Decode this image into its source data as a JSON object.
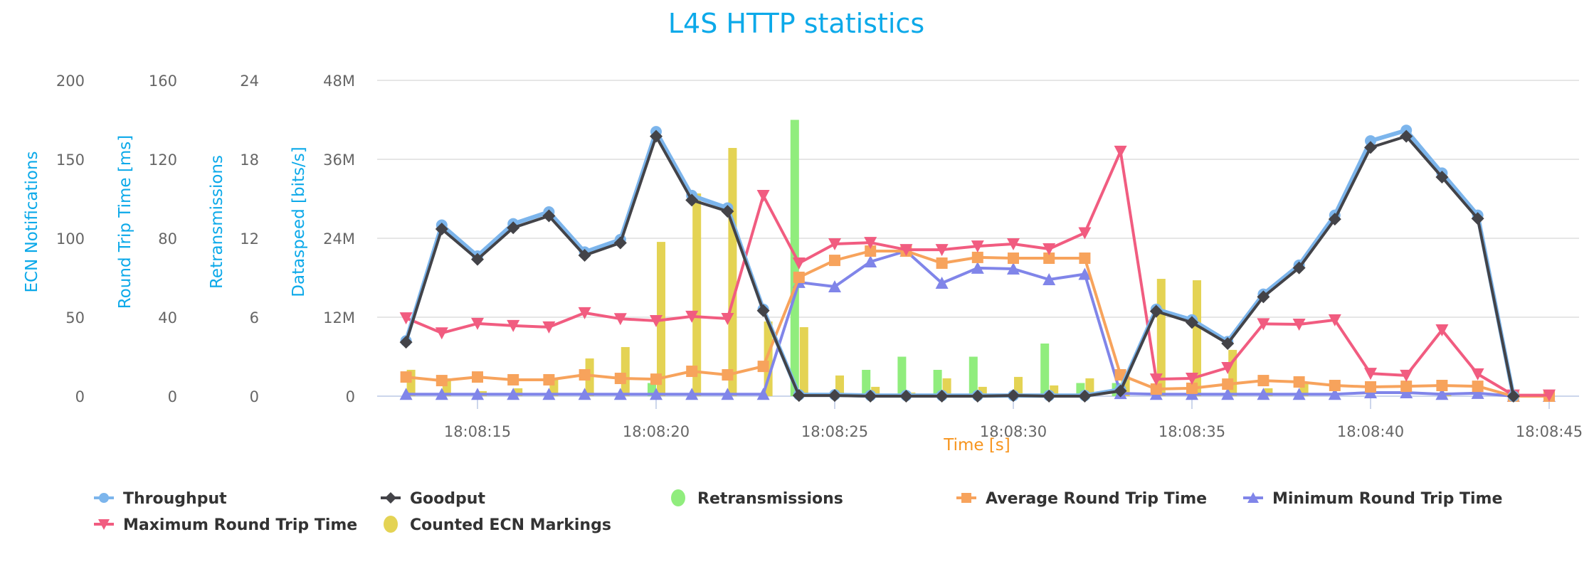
{
  "chart_data": {
    "type": "line",
    "title": "L4S HTTP statistics",
    "xlabel": "Time [s]",
    "x": [
      "18:08:13",
      "18:08:14",
      "18:08:15",
      "18:08:16",
      "18:08:17",
      "18:08:18",
      "18:08:19",
      "18:08:20",
      "18:08:21",
      "18:08:22",
      "18:08:23",
      "18:08:24",
      "18:08:25",
      "18:08:26",
      "18:08:27",
      "18:08:28",
      "18:08:29",
      "18:08:30",
      "18:08:31",
      "18:08:32",
      "18:08:33",
      "18:08:34",
      "18:08:35",
      "18:08:36",
      "18:08:37",
      "18:08:38",
      "18:08:39",
      "18:08:40",
      "18:08:41",
      "18:08:42",
      "18:08:43",
      "18:08:44",
      "18:08:45"
    ],
    "x_tick_labels": [
      "18:08:15",
      "18:08:20",
      "18:08:25",
      "18:08:30",
      "18:08:35",
      "18:08:40",
      "18:08:45"
    ],
    "grid": true,
    "legend_position": "bottom",
    "y_axes": [
      {
        "id": "ecn",
        "title": "ECN Notifications",
        "range": [
          0,
          200
        ],
        "ticks": [
          "0",
          "50",
          "100",
          "150",
          "200"
        ]
      },
      {
        "id": "rtt",
        "title": "Round Trip Time [ms]",
        "range": [
          0,
          160
        ],
        "ticks": [
          "0",
          "40",
          "80",
          "120",
          "160"
        ]
      },
      {
        "id": "retrans",
        "title": "Retransmissions",
        "range": [
          0,
          24
        ],
        "ticks": [
          "0",
          "6",
          "12",
          "18",
          "24"
        ]
      },
      {
        "id": "speed",
        "title": "Dataspeed [bits/s]",
        "range": [
          0,
          48000000
        ],
        "ticks": [
          "0",
          "12M",
          "24M",
          "36M",
          "48M"
        ]
      }
    ],
    "series": [
      {
        "name": "Throughput",
        "kind": "line",
        "axis": "speed",
        "unit_scale": 1000000,
        "color": "#7cb5ec",
        "marker": "circle",
        "values": [
          8.4,
          26.0,
          21.3,
          26.2,
          28.0,
          21.9,
          23.8,
          40.2,
          30.5,
          28.6,
          13.2,
          0.2,
          0.2,
          0.1,
          0.1,
          0.1,
          0.1,
          0.1,
          0.1,
          0.1,
          1.0,
          13.2,
          11.6,
          8.3,
          15.5,
          19.9,
          27.5,
          38.8,
          40.4,
          33.9,
          27.5,
          0,
          null
        ]
      },
      {
        "name": "Goodput",
        "kind": "line",
        "axis": "speed",
        "unit_scale": 1000000,
        "color": "#434348",
        "marker": "diamond",
        "values": [
          8.2,
          25.4,
          20.8,
          25.6,
          27.4,
          21.4,
          23.3,
          39.5,
          29.8,
          28.1,
          13.0,
          0.1,
          0.1,
          0,
          0,
          0,
          0,
          0.1,
          0,
          0,
          0.8,
          12.9,
          11.2,
          8.0,
          15.1,
          19.5,
          26.9,
          37.8,
          39.5,
          33.3,
          27.0,
          0,
          null
        ]
      },
      {
        "name": "Retransmissions",
        "kind": "bar",
        "axis": "retrans",
        "color": "#90ed7d",
        "marker": "circle",
        "values": [
          0,
          0,
          0,
          0,
          0,
          0,
          0,
          1,
          0,
          0,
          0,
          21,
          0,
          2,
          3,
          2,
          3,
          0,
          4,
          1,
          1,
          0,
          0,
          0,
          0,
          0,
          0,
          0,
          0,
          0,
          0,
          0,
          0
        ]
      },
      {
        "name": "Average Round Trip Time",
        "kind": "line",
        "axis": "rtt",
        "color": "#f7a35c",
        "marker": "square",
        "values": [
          9.7,
          7.9,
          9.7,
          8.3,
          8.3,
          10.8,
          9.0,
          8.6,
          12.6,
          10.8,
          15.1,
          60.2,
          68.8,
          73.5,
          73.5,
          67.4,
          70.3,
          69.9,
          69.9,
          69.9,
          10.8,
          3.6,
          4.0,
          6.1,
          7.9,
          7.2,
          5.4,
          4.7,
          5.0,
          5.4,
          5.0,
          0,
          0
        ]
      },
      {
        "name": "Minimum Round Trip Time",
        "kind": "line",
        "axis": "rtt",
        "color": "#8085e9",
        "marker": "triangle",
        "values": [
          1,
          1,
          1,
          1,
          1,
          1,
          1,
          1,
          1,
          1,
          1,
          57.7,
          55.5,
          68.1,
          73.5,
          57.3,
          64.9,
          64.5,
          59.1,
          61.8,
          1.4,
          1,
          1,
          1,
          1,
          1,
          1,
          1.8,
          1.8,
          1,
          1.5,
          0,
          0
        ]
      },
      {
        "name": "Maximum Round Trip Time",
        "kind": "line",
        "axis": "rtt",
        "color": "#f15c80",
        "marker": "triangle-down",
        "values": [
          39.6,
          32.0,
          36.8,
          35.7,
          35.0,
          42.2,
          39.2,
          38.2,
          40.4,
          39.3,
          101.6,
          67.4,
          77.1,
          77.8,
          74.2,
          74.2,
          76.0,
          77.1,
          74.6,
          82.7,
          124.0,
          8.6,
          9.0,
          14.4,
          36.6,
          36.4,
          38.6,
          11.5,
          10.5,
          33.5,
          11.2,
          0.5,
          0.5
        ]
      },
      {
        "name": "Counted ECN Markings",
        "kind": "bar",
        "axis": "ecn",
        "color": "#e4d354",
        "marker": "circle",
        "values": [
          16.7,
          11.3,
          3.2,
          5.0,
          11.3,
          23.9,
          31.1,
          97.7,
          128.4,
          157.2,
          47.3,
          43.7,
          13.1,
          5.9,
          2.3,
          11.3,
          5.9,
          12.2,
          6.8,
          11.3,
          13.1,
          74.3,
          73.4,
          29.3,
          5.0,
          7.7,
          0,
          0,
          0,
          2.3,
          0,
          0,
          0
        ]
      }
    ],
    "legend_order": [
      "Throughput",
      "Goodput",
      "Retransmissions",
      "Average Round Trip Time",
      "Minimum Round Trip Time",
      "Maximum Round Trip Time",
      "Counted ECN Markings"
    ]
  }
}
